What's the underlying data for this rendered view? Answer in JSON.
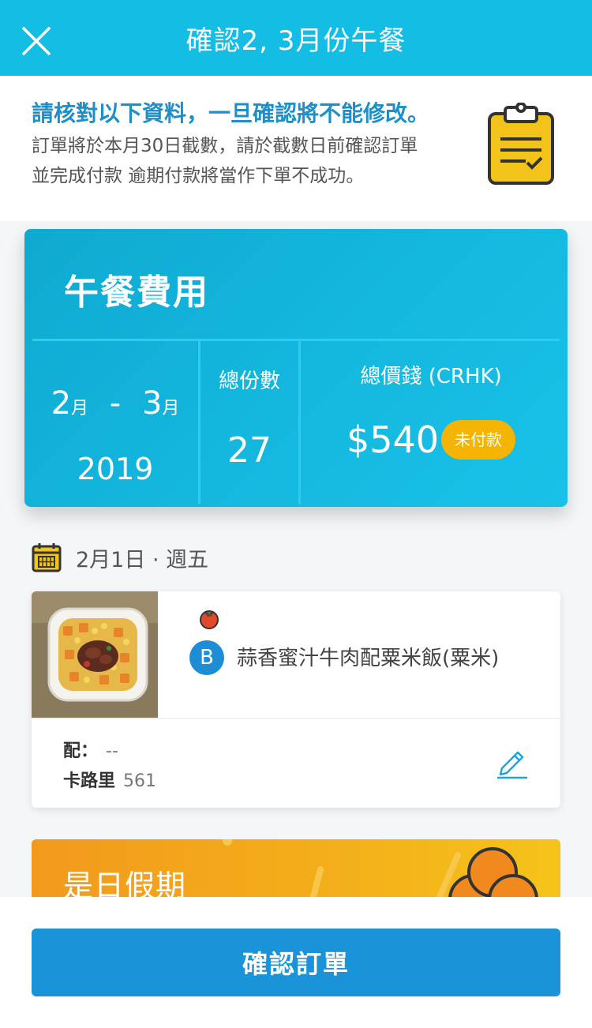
{
  "header": {
    "title": "確認2, 3月份午餐",
    "close_icon": "close-icon"
  },
  "notice": {
    "headline": "請核對以下資料，一旦確認將不能修改。",
    "desc_line1": "訂單將於本月30日截數，請於截數日前確認訂單",
    "desc_line2": "並完成付款 逾期付款將當作下單不成功。",
    "icon": "clipboard-icon"
  },
  "cost_card": {
    "title": "午餐費用",
    "month_from": "2",
    "month_to": "3",
    "month_unit": "月",
    "range_sep": "-",
    "year": "2019",
    "qty_label": "總份數",
    "qty_value": "27",
    "total_label": "總價錢 (CRHK)",
    "total_value": "$540",
    "status_badge": "未付款"
  },
  "day": {
    "date_label": "2月1日 · 週五",
    "icon": "calendar-icon"
  },
  "meal": {
    "letter": "B",
    "name": "蒜香蜜汁牛肉配粟米飯(粟米)",
    "side_label": "配：",
    "side_value": "--",
    "calorie_label": "卡路里",
    "calorie_value": "561",
    "icons": [
      "tomato-icon",
      "edit-pencil-icon"
    ]
  },
  "holiday": {
    "text": "是日假期"
  },
  "footer": {
    "confirm_label": "確認訂單"
  },
  "colors": {
    "header": "#14bde3",
    "headline": "#1f8fc9",
    "badge": "#f4b400",
    "button": "#1a93d9",
    "holiday": "#f29a1c"
  }
}
